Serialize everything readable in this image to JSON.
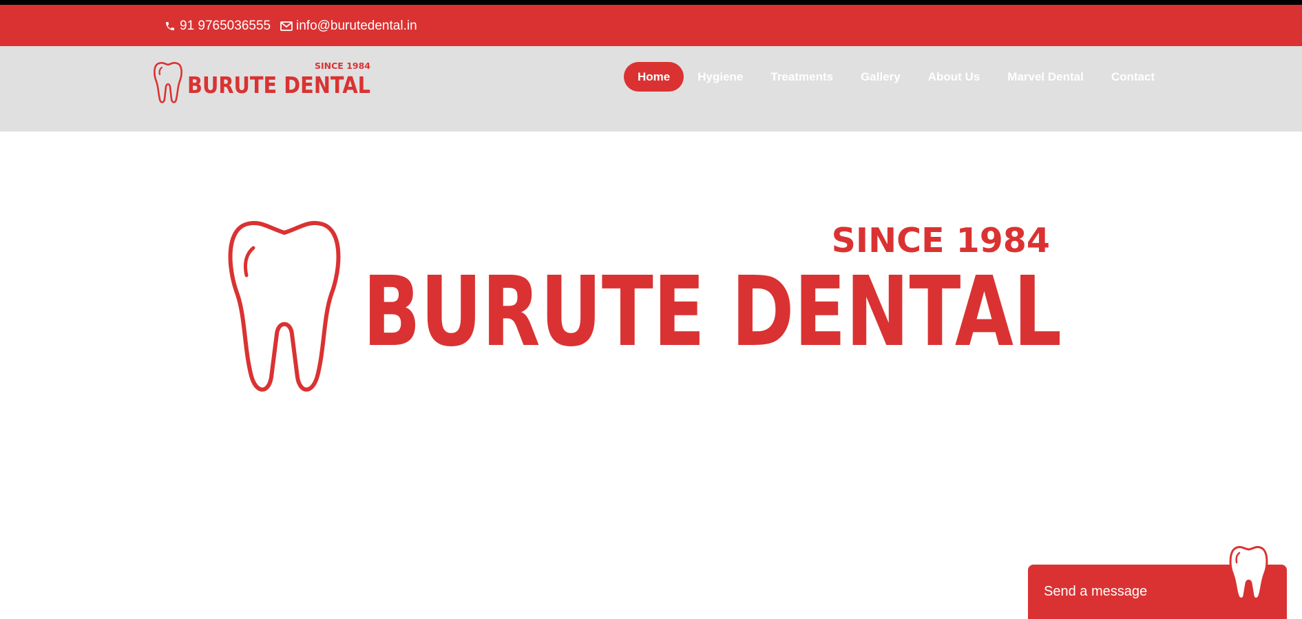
{
  "contact": {
    "phone": "91 9765036555",
    "email": "info@burutedental.in",
    "phone_icon": "phone-icon",
    "email_icon": "envelope-icon"
  },
  "brand": {
    "name": "BURUTE DENTAL",
    "tagline": "SINCE 1984",
    "color": "#da3232"
  },
  "nav": {
    "items": [
      {
        "label": "Home",
        "active": true
      },
      {
        "label": "Hygiene",
        "active": false
      },
      {
        "label": "Treatments",
        "active": false
      },
      {
        "label": "Gallery",
        "active": false
      },
      {
        "label": "About Us",
        "active": false
      },
      {
        "label": "Marvel Dental",
        "active": false
      },
      {
        "label": "Contact",
        "active": false
      }
    ]
  },
  "chat": {
    "label": "Send a message",
    "icon": "tooth-icon"
  },
  "colors": {
    "brand_red": "#da3232",
    "header_bg": "#e0e0e0",
    "top_strip": "#000000"
  }
}
